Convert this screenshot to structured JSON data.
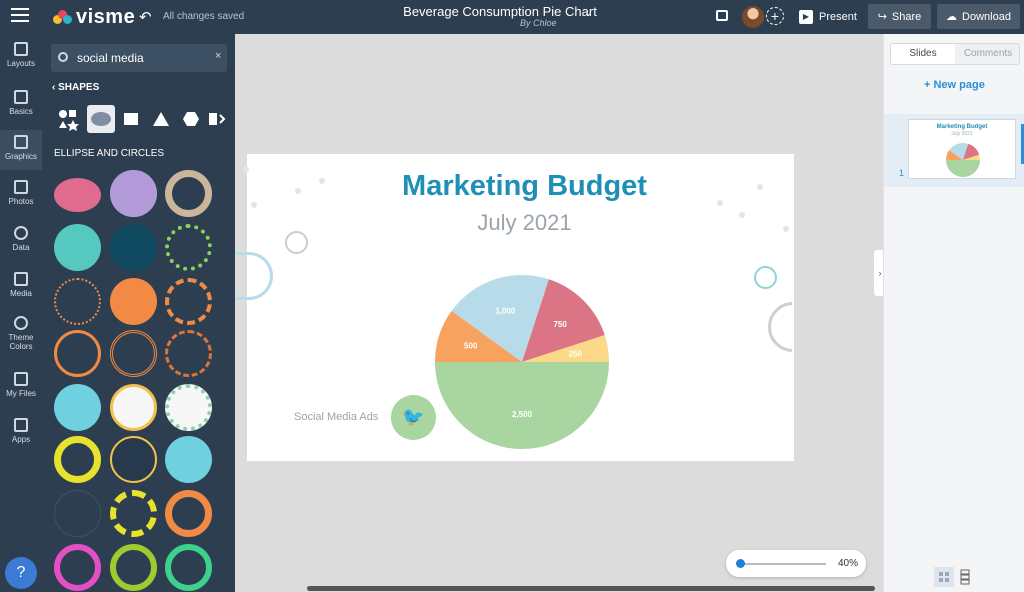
{
  "topbar": {
    "logo": "visme",
    "save_status": "All changes saved",
    "doc_title": "Beverage Consumption Pie Chart",
    "doc_author": "By Chloe",
    "present_label": "Present",
    "share_label": "Share",
    "download_label": "Download",
    "accent": "#2d3e50"
  },
  "rail": {
    "items": [
      {
        "label": "Layouts",
        "icon": "layouts-icon"
      },
      {
        "label": "Basics",
        "icon": "basics-icon"
      },
      {
        "label": "Graphics",
        "icon": "graphics-icon"
      },
      {
        "label": "Photos",
        "icon": "photos-icon"
      },
      {
        "label": "Data",
        "icon": "data-icon"
      },
      {
        "label": "Media",
        "icon": "media-icon"
      },
      {
        "label": "Theme Colors",
        "icon": "palette-icon"
      },
      {
        "label": "My Files",
        "icon": "files-icon"
      },
      {
        "label": "Apps",
        "icon": "apps-icon"
      }
    ],
    "help": "?"
  },
  "panel": {
    "search_value": "social media",
    "clear": "×",
    "back_label": "SHAPES",
    "section_title": "ELLIPSE AND CIRCLES"
  },
  "slide": {
    "title": "Marketing Budget",
    "subtitle": "July 2021",
    "legend_label": "Social Media Ads",
    "title_color": "#1e8fb5"
  },
  "chart_data": {
    "type": "pie",
    "slices": [
      {
        "label": "2,500",
        "value": 2500,
        "color": "#a8d5a0"
      },
      {
        "label": "500",
        "value": 500,
        "color": "#f7a25e"
      },
      {
        "label": "1,000",
        "value": 1000,
        "color": "#b7dbe8"
      },
      {
        "label": "750",
        "value": 750,
        "color": "#db7485"
      },
      {
        "label": "250",
        "value": 250,
        "color": "#fcd889"
      }
    ]
  },
  "zoom": {
    "value": "40%",
    "level": 0.4
  },
  "right": {
    "tab_slides": "Slides",
    "tab_comments": "Comments",
    "new_page": "+ New page",
    "thumb_number": "1",
    "thumb_title": "Marketing Budget",
    "thumb_sub": "July 2021"
  }
}
